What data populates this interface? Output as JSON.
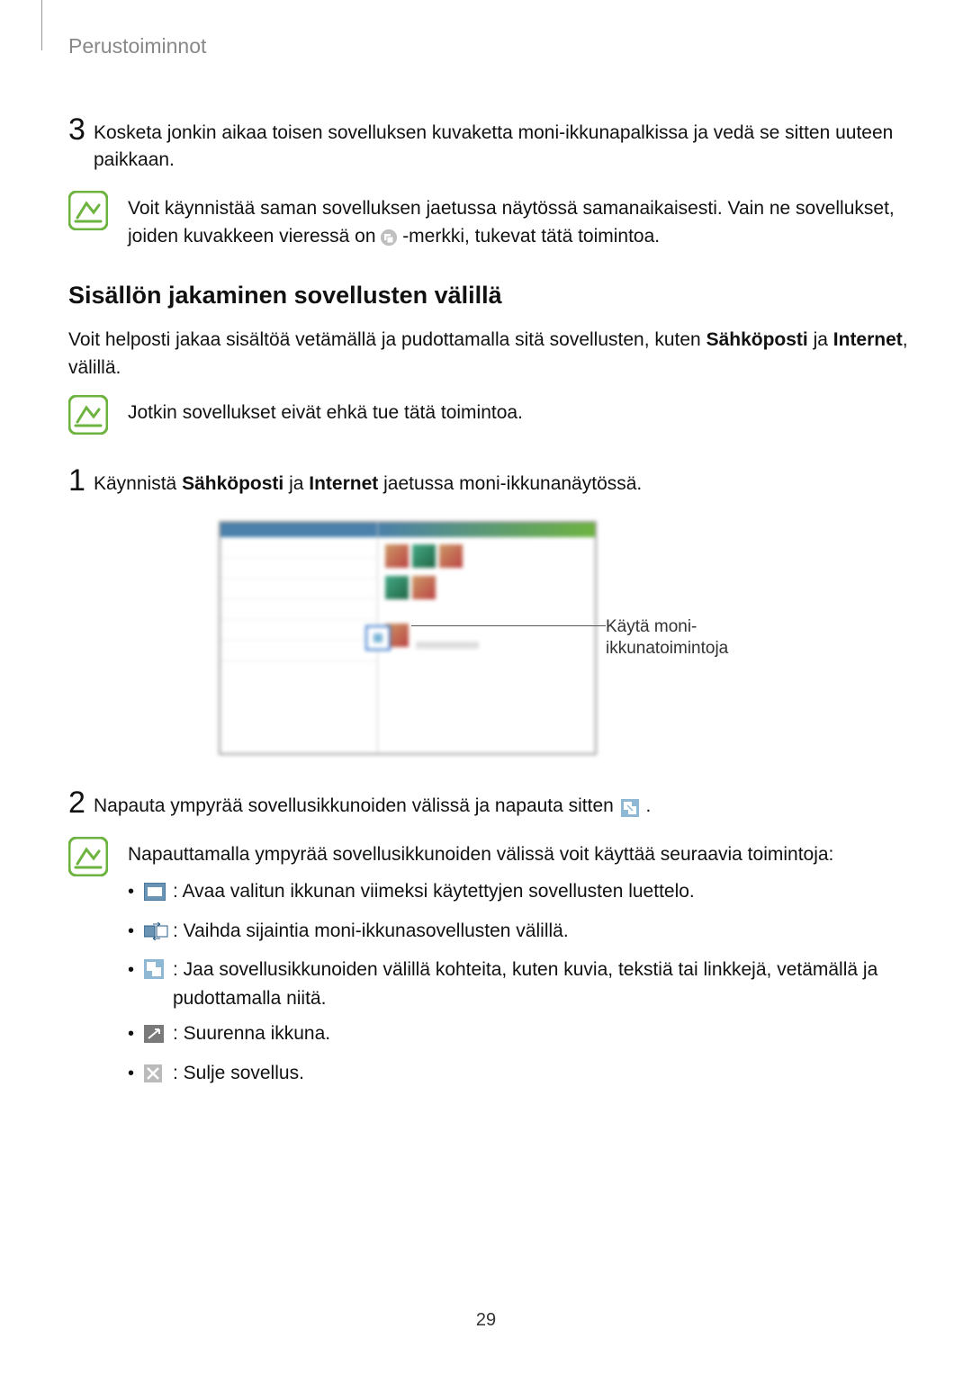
{
  "header": {
    "section": "Perustoiminnot"
  },
  "step3": {
    "num": "3",
    "text": "Kosketa jonkin aikaa toisen sovelluksen kuvaketta moni-ikkunapalkissa ja vedä se sitten uuteen paikkaan."
  },
  "note1": {
    "text_a": "Voit käynnistää saman sovelluksen jaetussa näytössä samanaikaisesti. Vain ne sovellukset, joiden kuvakkeen vieressä on ",
    "text_b": "-merkki, tukevat tätä toimintoa."
  },
  "section_heading": "Sisällön jakaminen sovellusten välillä",
  "intro": {
    "a": "Voit helposti jakaa sisältöä vetämällä ja pudottamalla sitä sovellusten, kuten ",
    "b": "Sähköposti",
    "c": " ja ",
    "d": "Internet",
    "e": ", välillä."
  },
  "note2": {
    "text": "Jotkin sovellukset eivät ehkä tue tätä toimintoa."
  },
  "step1": {
    "num": "1",
    "a": "Käynnistä ",
    "b": "Sähköposti",
    "c": " ja ",
    "d": "Internet",
    "e": " jaetussa moni-ikkunanäytössä."
  },
  "figure": {
    "callout": "Käytä moni-ikkunatoimintoja"
  },
  "step2": {
    "num": "2",
    "a": "Napauta ympyrää sovellusikkunoiden välissä ja napauta sitten ",
    "b": "."
  },
  "note3": {
    "lead": "Napauttamalla ympyrää sovellusikkunoiden välissä voit käyttää seuraavia toimintoja:",
    "items": [
      {
        "icon": "recent",
        "text": ": Avaa valitun ikkunan viimeksi käytettyjen sovellusten luettelo."
      },
      {
        "icon": "swap",
        "text": ": Vaihda sijaintia moni-ikkunasovellusten välillä."
      },
      {
        "icon": "share",
        "text": ": Jaa sovellusikkunoiden välillä kohteita, kuten kuvia, tekstiä tai linkkejä, vetämällä ja pudottamalla niitä."
      },
      {
        "icon": "expand",
        "text": ": Suurenna ikkuna."
      },
      {
        "icon": "close",
        "text": ": Sulje sovellus."
      }
    ]
  },
  "page_number": "29"
}
